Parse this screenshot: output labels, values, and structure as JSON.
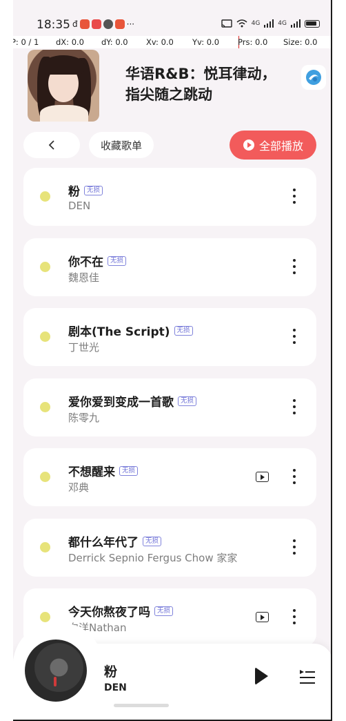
{
  "status_bar": {
    "time": "18:35",
    "overflow": "···",
    "signal_1": "4G",
    "signal_2": "4G"
  },
  "debug_overlay": {
    "p": "P: 0 / 1",
    "dx": "dX: 0.0",
    "dy": "dY: 0.0",
    "xv": "Xv: 0.0",
    "yv": "Yv: 0.0",
    "prs": "Prs: 0.0",
    "size": "Size: 0.0"
  },
  "header": {
    "title": "华语R&B：悦耳律动，指尖随之跳动"
  },
  "actions": {
    "back": "‹",
    "favorite": "收藏歌单",
    "play_all": "全部播放"
  },
  "songs": [
    {
      "title": "粉",
      "badge": "无损",
      "artist": "DEN",
      "has_mv": false
    },
    {
      "title": "你不在",
      "badge": "无损",
      "artist": "魏恩佳",
      "has_mv": false
    },
    {
      "title": "剧本(The Script)",
      "badge": "无损",
      "artist": "丁世光",
      "has_mv": false
    },
    {
      "title": "爱你爱到变成一首歌",
      "badge": "无损",
      "artist": "陈零九",
      "has_mv": false
    },
    {
      "title": "不想醒来",
      "badge": "无损",
      "artist": "邓典",
      "has_mv": true
    },
    {
      "title": "都什么年代了",
      "badge": "无损",
      "artist": "Derrick Sepnio Fergus Chow 家家",
      "has_mv": false
    },
    {
      "title": "今天你熬夜了吗",
      "badge": "无损",
      "artist": "向洋Nathan",
      "has_mv": true
    }
  ],
  "mini_player": {
    "title": "粉",
    "artist": "DEN"
  },
  "colors": {
    "accent": "#f25b5b",
    "dot": "#e7e37a",
    "badge": "#6c6fd6",
    "background": "#f7f3f6"
  }
}
